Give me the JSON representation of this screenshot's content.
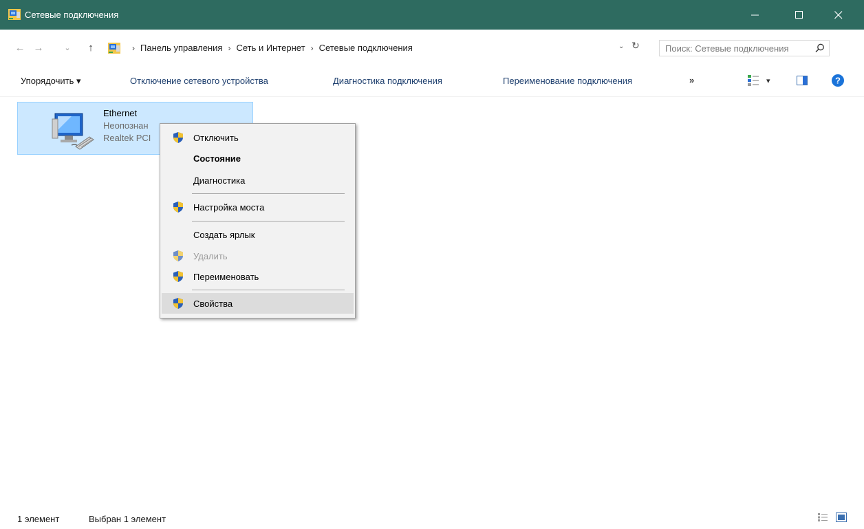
{
  "window": {
    "title": "Сетевые подключения",
    "accent": "#2e6b60",
    "buttons": {
      "minimize": "—",
      "maximize": "☐",
      "close": "✕"
    }
  },
  "nav": {
    "back": "←",
    "forward": "→",
    "recent": "⌄",
    "up": "↑"
  },
  "address": {
    "crumbs": [
      "Панель управления",
      "Сеть и Интернет",
      "Сетевые подключения"
    ],
    "separator": "›",
    "dropdown": "⌄",
    "refresh": "↻"
  },
  "search": {
    "placeholder": "Поиск: Сетевые подключения"
  },
  "commands": {
    "organize": "Упорядочить ▾",
    "disable": "Отключение сетевого устройства",
    "diagnose": "Диагностика подключения",
    "rename": "Переименование подключения",
    "more": "»",
    "view_dropdown": "▾"
  },
  "item": {
    "name": "Ethernet",
    "status": "Неопознан",
    "device": "Realtek PCI"
  },
  "context_menu": {
    "items": [
      {
        "label": "Отключить",
        "shield": true
      },
      {
        "label": "Состояние",
        "shield": false,
        "bold": true
      },
      {
        "label": "Диагностика",
        "shield": false
      },
      {
        "label": "Настройка моста",
        "shield": true
      },
      {
        "label": "Создать ярлык",
        "shield": false
      },
      {
        "label": "Удалить",
        "shield": true,
        "disabled": true
      },
      {
        "label": "Переименовать",
        "shield": true
      },
      {
        "label": "Свойства",
        "shield": true,
        "highlighted": true
      }
    ]
  },
  "status": {
    "count": "1 элемент",
    "selected": "Выбран 1 элемент"
  }
}
